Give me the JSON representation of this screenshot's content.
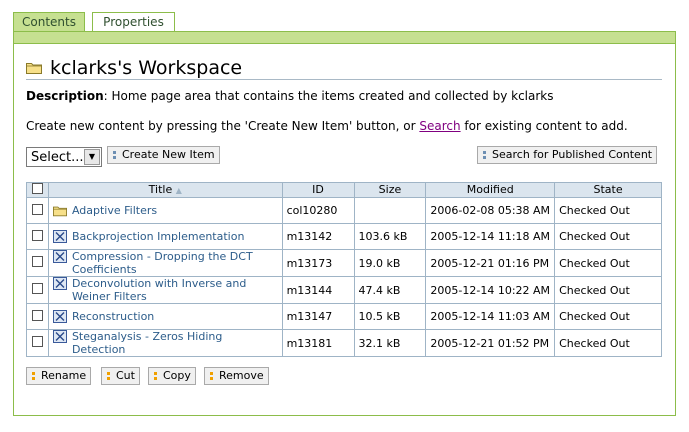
{
  "tabs": [
    {
      "label": "Contents",
      "active": true
    },
    {
      "label": "Properties",
      "active": false
    }
  ],
  "workspace": {
    "title": "kclarks's Workspace",
    "description_label": "Description",
    "description_text": ": Home page area that contains the items created and collected by kclarks",
    "create_prefix": "Create new content by pressing the 'Create New Item' button, or ",
    "search_link": "Search",
    "create_suffix": " for existing content to add."
  },
  "toolbar": {
    "select_value": "Select...",
    "create_button": "Create New Item",
    "search_published_button": "Search for Published Content"
  },
  "table": {
    "headers": {
      "title": "Title",
      "id": "ID",
      "size": "Size",
      "modified": "Modified",
      "state": "State"
    },
    "rows": [
      {
        "icon": "folder-icon",
        "title": "Adaptive Filters",
        "id": "col10280",
        "size": "",
        "modified": "2006-02-08 05:38 AM",
        "state": "Checked Out"
      },
      {
        "icon": "module-icon",
        "title": "Backprojection Implementation",
        "id": "m13142",
        "size": "103.6 kB",
        "modified": "2005-12-14 11:18 AM",
        "state": "Checked Out"
      },
      {
        "icon": "module-icon",
        "title": "Compression - Dropping the DCT Coefficients",
        "id": "m13173",
        "size": "19.0 kB",
        "modified": "2005-12-21 01:16 PM",
        "state": "Checked Out"
      },
      {
        "icon": "module-icon",
        "title": "Deconvolution with Inverse and Weiner Filters",
        "id": "m13144",
        "size": "47.4 kB",
        "modified": "2005-12-14 10:22 AM",
        "state": "Checked Out"
      },
      {
        "icon": "module-icon",
        "title": "Reconstruction",
        "id": "m13147",
        "size": "10.5 kB",
        "modified": "2005-12-14 11:03 AM",
        "state": "Checked Out"
      },
      {
        "icon": "module-icon",
        "title": "Steganalysis - Zeros Hiding Detection",
        "id": "m13181",
        "size": "32.1 kB",
        "modified": "2005-12-21 01:52 PM",
        "state": "Checked Out"
      }
    ]
  },
  "actions": {
    "rename": "Rename",
    "cut": "Cut",
    "copy": "Copy",
    "remove": "Remove"
  },
  "colors": {
    "accent_green": "#c6e091",
    "border_green": "#8cbd4a",
    "link_blue": "#2c5c8a",
    "visited_link": "#800080"
  }
}
